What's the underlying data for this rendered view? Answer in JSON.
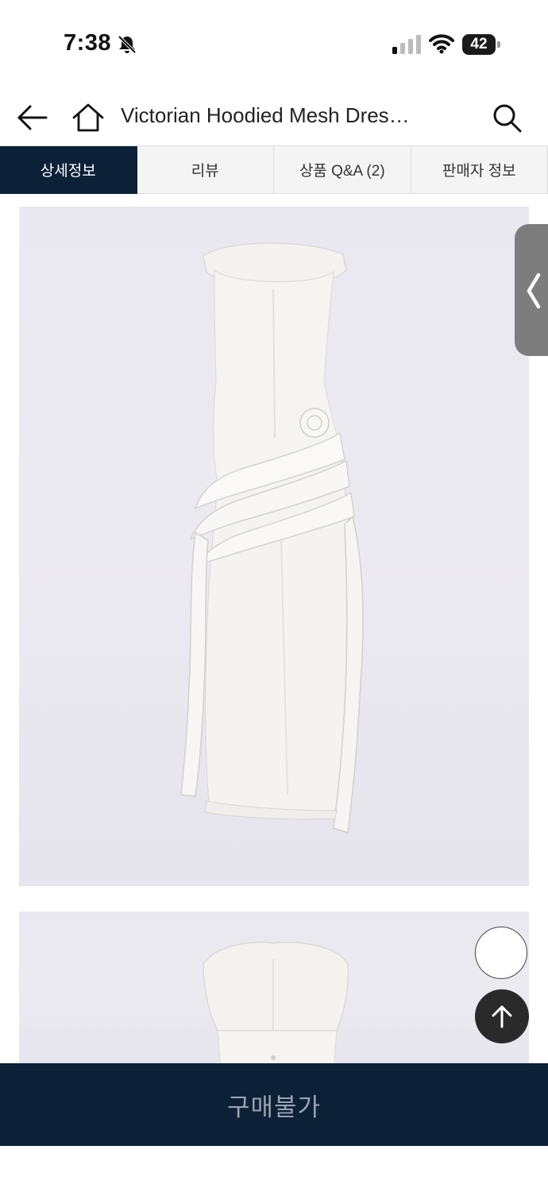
{
  "status_bar": {
    "time": "7:38",
    "battery": "42",
    "icons": [
      "bell-slash-icon",
      "cellular-signal-icon",
      "wifi-icon",
      "battery-icon"
    ]
  },
  "header": {
    "title": "Victorian Hoodied Mesh Dres…",
    "icons": [
      "arrow-left-icon",
      "home-icon",
      "search-icon"
    ]
  },
  "tabs": [
    {
      "label": "상세정보",
      "active": true
    },
    {
      "label": "리뷰",
      "active": false
    },
    {
      "label": "상품 Q&A (2)",
      "active": false
    },
    {
      "label": "판매자 정보",
      "active": false
    }
  ],
  "side_tab": {
    "icon": "chevron-left-icon"
  },
  "floating": {
    "top_icon": "arrow-up-icon"
  },
  "buy_bar": {
    "label": "구매불가"
  },
  "colors": {
    "navy": "#0c2038",
    "tab_bg": "#f4f4f4",
    "image_bg": "#eae9f0",
    "dress": "#f6f5f3"
  }
}
